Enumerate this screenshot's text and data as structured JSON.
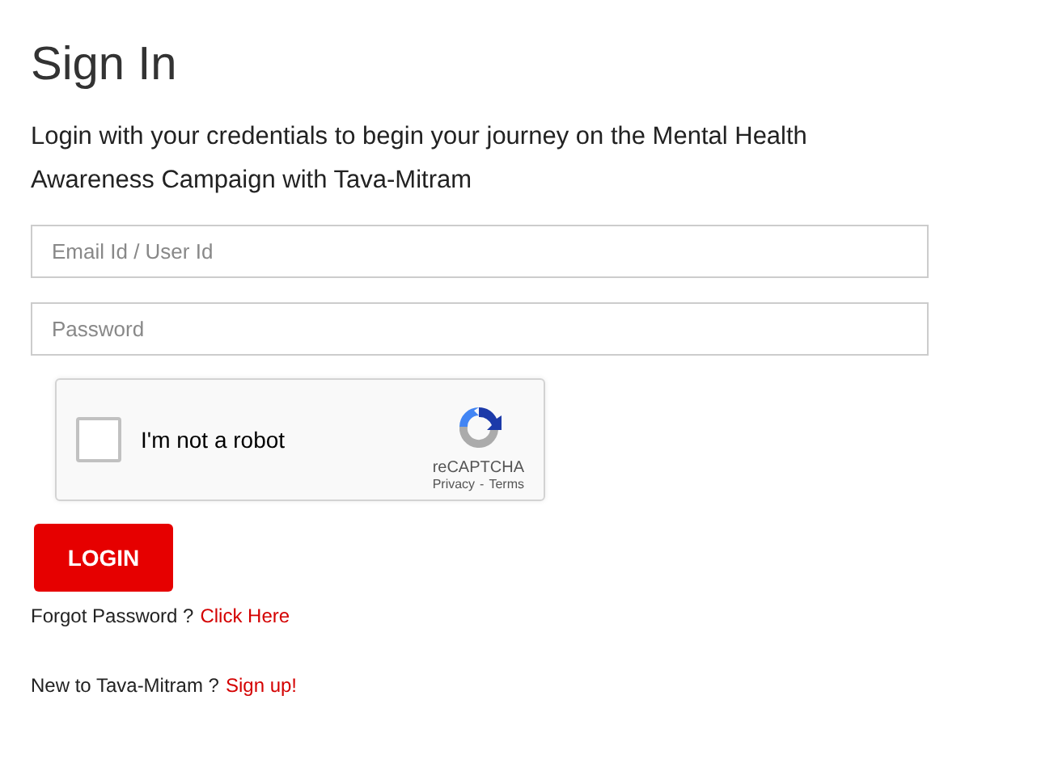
{
  "title": "Sign In",
  "intro": "Login with your credentials to begin your journey on the Mental Health Awareness Campaign with Tava-Mitram",
  "fields": [
    {
      "placeholder": "Email Id / User Id"
    },
    {
      "placeholder": "Password"
    }
  ],
  "captcha": {
    "label": "I'm not a robot",
    "checked": false,
    "brand": "reCAPTCHA",
    "privacy": "Privacy",
    "separator": "-",
    "terms": "Terms"
  },
  "login_button": "LOGIN",
  "forgot": {
    "text": "Forgot Password ?",
    "link": "Click Here"
  },
  "signup": {
    "text": "New to Tava-Mitram ?",
    "link": "Sign up!"
  }
}
